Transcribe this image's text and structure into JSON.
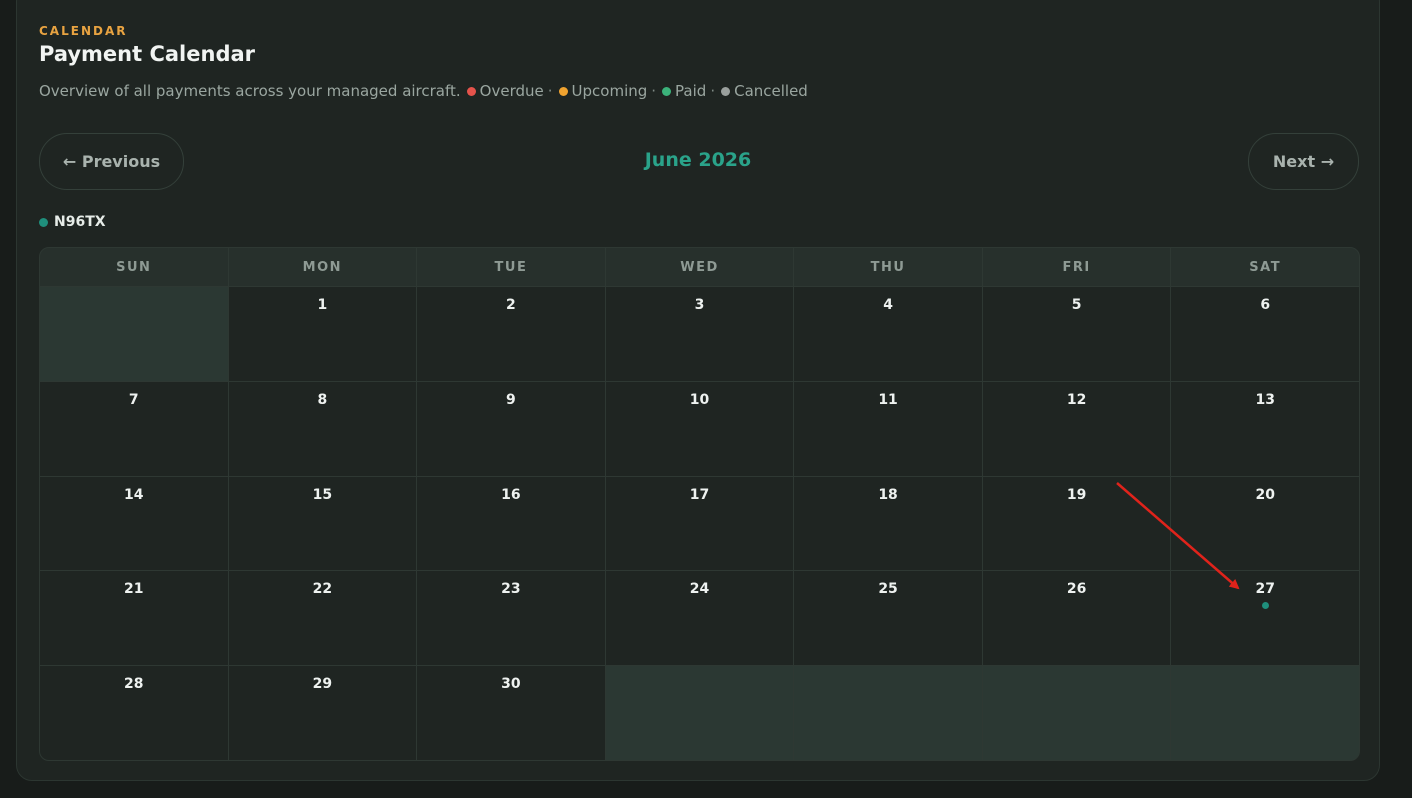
{
  "header": {
    "eyebrow": "CALENDAR",
    "title": "Payment Calendar",
    "subtitle": "Overview of all payments across your managed aircraft."
  },
  "legend": [
    {
      "label": "Overdue",
      "color": "#e5534b",
      "sep": "·"
    },
    {
      "label": "Upcoming",
      "color": "#f0a32f",
      "sep": "·"
    },
    {
      "label": "Paid",
      "color": "#3bb27a",
      "sep": "·"
    },
    {
      "label": "Cancelled",
      "color": "#9aa09d",
      "sep": ""
    }
  ],
  "nav": {
    "previous_label": "← Previous",
    "next_label": "Next →",
    "month_label": "June 2026"
  },
  "aircraft": {
    "label": "N96TX",
    "color": "#1f8f7c"
  },
  "calendar": {
    "weekdays": [
      "SUN",
      "MON",
      "TUE",
      "WED",
      "THU",
      "FRI",
      "SAT"
    ],
    "leading_empty": 1,
    "days_in_month": 30,
    "trailing_empty": 4,
    "events": [
      {
        "day": 27,
        "aircraft": "N96TX",
        "color": "#1f8f7c"
      }
    ]
  }
}
